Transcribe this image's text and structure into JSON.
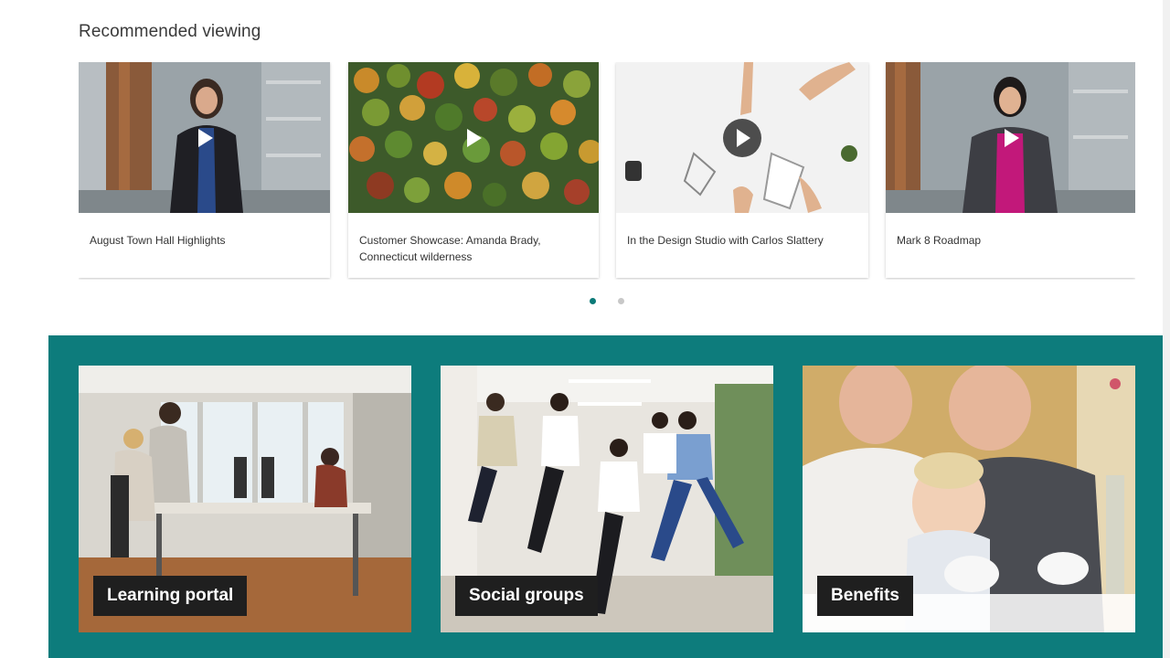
{
  "recommended": {
    "title": "Recommended viewing",
    "videos": [
      {
        "title": "August Town Hall Highlights",
        "icon": "play-icon"
      },
      {
        "title": "Customer Showcase: Amanda Brady, Connecticut wilderness",
        "icon": "play-icon"
      },
      {
        "title": "In the Design Studio with Carlos Slattery",
        "icon": "play-icon"
      },
      {
        "title": "Mark 8 Roadmap",
        "icon": "play-icon"
      }
    ],
    "pager": {
      "pages": 2,
      "active_page": 1
    }
  },
  "quick_links": {
    "background_color": "#0d7c7c",
    "tiles": [
      {
        "label": "Learning portal"
      },
      {
        "label": "Social groups"
      },
      {
        "label": "Benefits"
      }
    ]
  }
}
